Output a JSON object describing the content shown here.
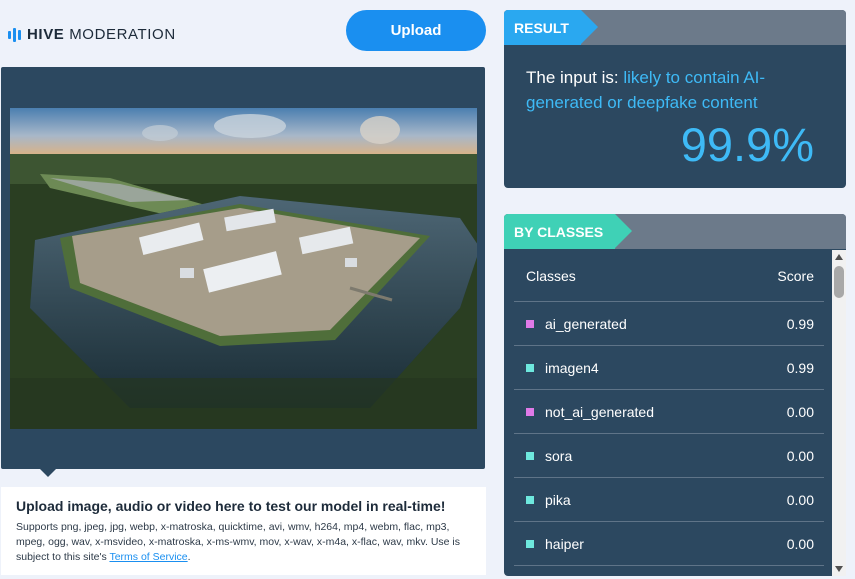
{
  "header": {
    "brand_bold": "HIVE",
    "brand_light": "MODERATION",
    "upload_label": "Upload"
  },
  "upload_info": {
    "title": "Upload image, audio or video here to test our model in real-time!",
    "desc_prefix": "Supports png, jpeg, jpg, webp, x-matroska, quicktime, avi, wmv, h264, mp4, webm, flac, mp3, mpeg, ogg, wav, x-msvideo, x-matroska, x-ms-wmv, mov, x-wav, x-m4a, x-flac, wav, mkv. Use is subject to this site's ",
    "tos_link": "Terms of Service",
    "desc_suffix": "."
  },
  "result": {
    "tag": "RESULT",
    "prefix": "The input is: ",
    "verdict": "likely to contain AI-generated or deepfake content",
    "percent": "99.9%"
  },
  "classes": {
    "tag": "BY CLASSES",
    "col_class": "Classes",
    "col_score": "Score",
    "rows": [
      {
        "name": "ai_generated",
        "score": "0.99",
        "color": "#e07ae8"
      },
      {
        "name": "imagen4",
        "score": "0.99",
        "color": "#6ee8de"
      },
      {
        "name": "not_ai_generated",
        "score": "0.00",
        "color": "#e07ae8"
      },
      {
        "name": "sora",
        "score": "0.00",
        "color": "#6ee8de"
      },
      {
        "name": "pika",
        "score": "0.00",
        "color": "#6ee8de"
      },
      {
        "name": "haiper",
        "score": "0.00",
        "color": "#6ee8de"
      }
    ]
  },
  "colors": {
    "accent_blue": "#1a8ff0",
    "result_blue": "#3ebaf6",
    "classes_teal": "#3fd1b6",
    "panel": "#2c4860"
  }
}
